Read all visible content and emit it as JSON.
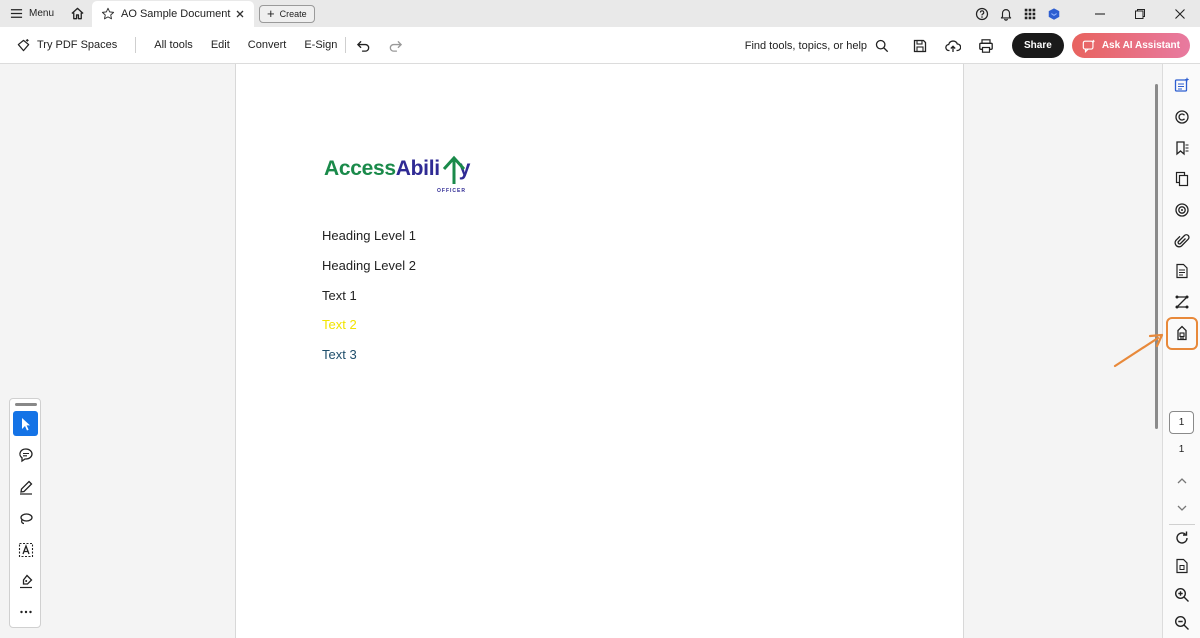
{
  "titlebar": {
    "menu_label": "Menu",
    "tab_title": "AO Sample Document",
    "create_label": "Create",
    "icons": [
      "help-icon",
      "bell-icon",
      "apps-grid-icon",
      "account-icon"
    ]
  },
  "toolbar": {
    "spaces_label": "Try PDF Spaces",
    "menu": [
      "All tools",
      "Edit",
      "Convert",
      "E-Sign"
    ],
    "find_label": "Find tools, topics, or help",
    "share_label": "Share",
    "ai_label": "Ask AI Assistant"
  },
  "document": {
    "logo_part_a": "Access",
    "logo_part_b": "Abili",
    "logo_part_c": "y",
    "logo_sub": "OFFICER",
    "lines": [
      {
        "text": "Heading Level 1",
        "color": "#222222"
      },
      {
        "text": "Heading Level 2",
        "color": "#222222"
      },
      {
        "text": "Text 1",
        "color": "#222222"
      },
      {
        "text": "Text 2",
        "color": "#f2e400"
      },
      {
        "text": "Text 3",
        "color": "#1f4e6b"
      }
    ]
  },
  "page_nav": {
    "current": "1",
    "total": "1"
  },
  "colors": {
    "accent": "#1473e6",
    "highlight": "#e8893a",
    "logo_green": "#1a8a4a",
    "logo_blue": "#2f2a94"
  }
}
